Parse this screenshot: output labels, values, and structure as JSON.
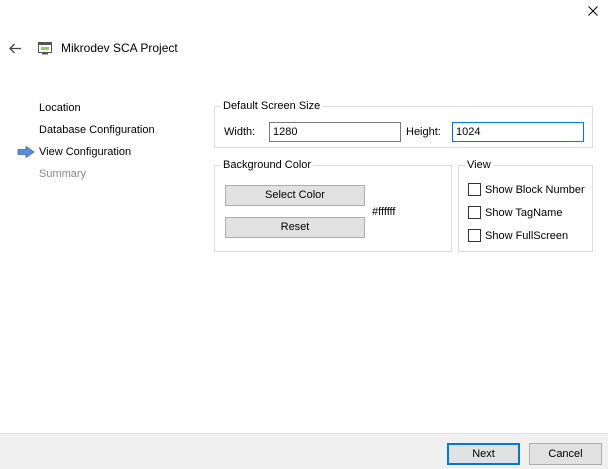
{
  "window": {
    "title": "Mikrodev SCA Project",
    "close_icon": "close-icon",
    "back_icon": "back-arrow-icon",
    "app_icon": "project-icon"
  },
  "steps": [
    {
      "label": "Location",
      "state": "done"
    },
    {
      "label": "Database Configuration",
      "state": "done"
    },
    {
      "label": "View Configuration",
      "state": "current"
    },
    {
      "label": "Summary",
      "state": "pending"
    }
  ],
  "screen_size": {
    "group_label": "Default Screen Size",
    "width_label": "Width:",
    "width_value": "1280",
    "height_label": "Height:",
    "height_value": "1024"
  },
  "background": {
    "group_label": "Background Color",
    "select_label": "Select Color",
    "reset_label": "Reset",
    "color_value": "#ffffff"
  },
  "view": {
    "group_label": "View",
    "options": [
      {
        "label": "Show Block Number",
        "checked": false
      },
      {
        "label": "Show TagName",
        "checked": false
      },
      {
        "label": "Show FullScreen",
        "checked": false
      }
    ]
  },
  "footer": {
    "next_label": "Next",
    "cancel_label": "Cancel"
  },
  "colors": {
    "accent": "#0078d7",
    "current_step_arrow": "#5b8dd6"
  }
}
